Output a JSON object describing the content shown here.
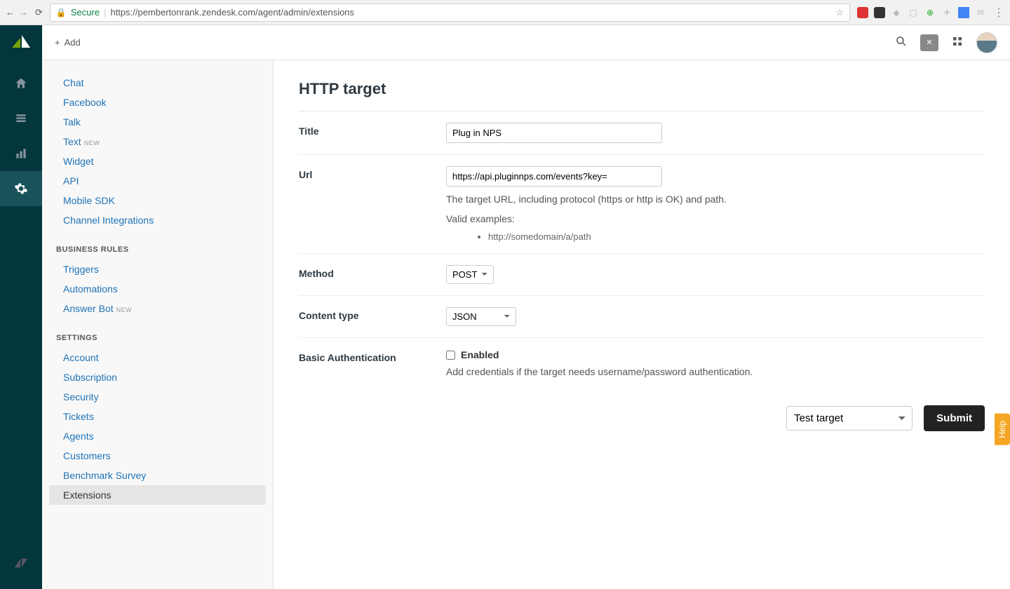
{
  "browser": {
    "secure_label": "Secure",
    "url": "https://pembertonrank.zendesk.com/agent/admin/extensions"
  },
  "topbar": {
    "add_label": "Add"
  },
  "sidebar": {
    "group_channels": [
      {
        "label": "Chat"
      },
      {
        "label": "Facebook"
      },
      {
        "label": "Talk"
      },
      {
        "label": "Text",
        "new": true
      },
      {
        "label": "Widget"
      },
      {
        "label": "API"
      },
      {
        "label": "Mobile SDK"
      },
      {
        "label": "Channel Integrations"
      }
    ],
    "section_business": "BUSINESS RULES",
    "group_business": [
      {
        "label": "Triggers"
      },
      {
        "label": "Automations"
      },
      {
        "label": "Answer Bot",
        "new": true
      }
    ],
    "section_settings": "SETTINGS",
    "group_settings": [
      {
        "label": "Account"
      },
      {
        "label": "Subscription"
      },
      {
        "label": "Security"
      },
      {
        "label": "Tickets"
      },
      {
        "label": "Agents"
      },
      {
        "label": "Customers"
      },
      {
        "label": "Benchmark Survey"
      },
      {
        "label": "Extensions",
        "selected": true
      }
    ],
    "new_badge": "NEW"
  },
  "form": {
    "heading": "HTTP target",
    "title_label": "Title",
    "title_value": "Plug in NPS",
    "url_label": "Url",
    "url_value": "https://api.pluginnps.com/events?key=",
    "url_hint": "The target URL, including protocol (https or http is OK) and path.",
    "url_examples_label": "Valid examples:",
    "url_example1": "http://somedomain/a/path",
    "method_label": "Method",
    "method_value": "POST",
    "content_label": "Content type",
    "content_value": "JSON",
    "auth_label": "Basic Authentication",
    "auth_enabled_label": "Enabled",
    "auth_hint": "Add credentials if the target needs username/password authentication.",
    "test_action": "Test target",
    "submit_label": "Submit"
  },
  "help_tab": "Help"
}
